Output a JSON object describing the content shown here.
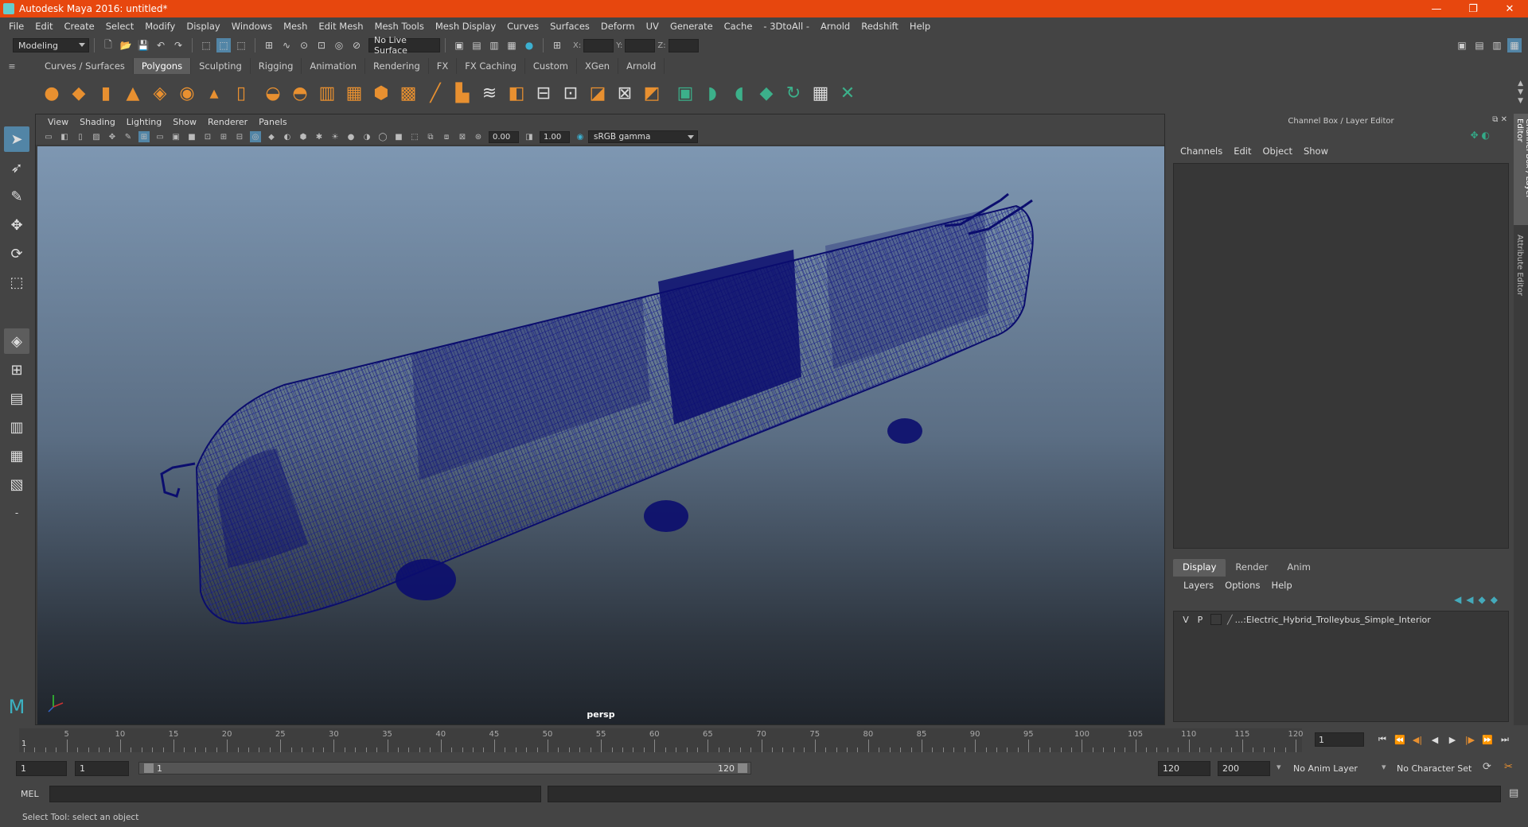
{
  "window": {
    "title": "Autodesk Maya 2016: untitled*"
  },
  "menubar": [
    "File",
    "Edit",
    "Create",
    "Select",
    "Modify",
    "Display",
    "Windows",
    "Mesh",
    "Edit Mesh",
    "Mesh Tools",
    "Mesh Display",
    "Curves",
    "Surfaces",
    "Deform",
    "UV",
    "Generate",
    "Cache",
    "- 3DtoAll -",
    "Arnold",
    "Redshift",
    "Help"
  ],
  "statusline": {
    "mode": "Modeling",
    "live_surface": "No Live Surface",
    "x_label": "X:",
    "y_label": "Y:",
    "z_label": "Z:"
  },
  "shelf": {
    "tabs": [
      "Curves / Surfaces",
      "Polygons",
      "Sculpting",
      "Rigging",
      "Animation",
      "Rendering",
      "FX",
      "FX Caching",
      "Custom",
      "XGen",
      "Arnold"
    ],
    "active_tab": "Polygons"
  },
  "viewport": {
    "menu": [
      "View",
      "Shading",
      "Lighting",
      "Show",
      "Renderer",
      "Panels"
    ],
    "exposure": "0.00",
    "gamma": "1.00",
    "color_space": "sRGB gamma",
    "camera": "persp"
  },
  "channel_box": {
    "title": "Channel Box / Layer Editor",
    "menu": [
      "Channels",
      "Edit",
      "Object",
      "Show"
    ]
  },
  "layer_editor": {
    "tabs": [
      "Display",
      "Render",
      "Anim"
    ],
    "active_tab": "Display",
    "menu": [
      "Layers",
      "Options",
      "Help"
    ],
    "layers": [
      {
        "v": "V",
        "p": "P",
        "name": "...:Electric_Hybrid_Trolleybus_Simple_Interior"
      }
    ]
  },
  "side_tabs": [
    "Channel Box / Layer Editor",
    "Attribute Editor"
  ],
  "timeline": {
    "ticks": [
      "5",
      "10",
      "15",
      "20",
      "25",
      "30",
      "35",
      "40",
      "45",
      "50",
      "55",
      "60",
      "65",
      "70",
      "75",
      "80",
      "85",
      "90",
      "95",
      "100",
      "105",
      "110",
      "115",
      "120"
    ],
    "start_label": "1",
    "current_frame": "1"
  },
  "range": {
    "start": "1",
    "playback_start": "1",
    "slider_start": "1",
    "slider_end": "120",
    "playback_end": "120",
    "end": "200",
    "anim_layer": "No Anim Layer",
    "character_set": "No Character Set"
  },
  "command": {
    "label": "MEL"
  },
  "help_line": "Select Tool: select an object",
  "colors": {
    "titlebar": "#e7470e",
    "wireframe": "#0b0d6e",
    "accent": "#5285a6"
  }
}
